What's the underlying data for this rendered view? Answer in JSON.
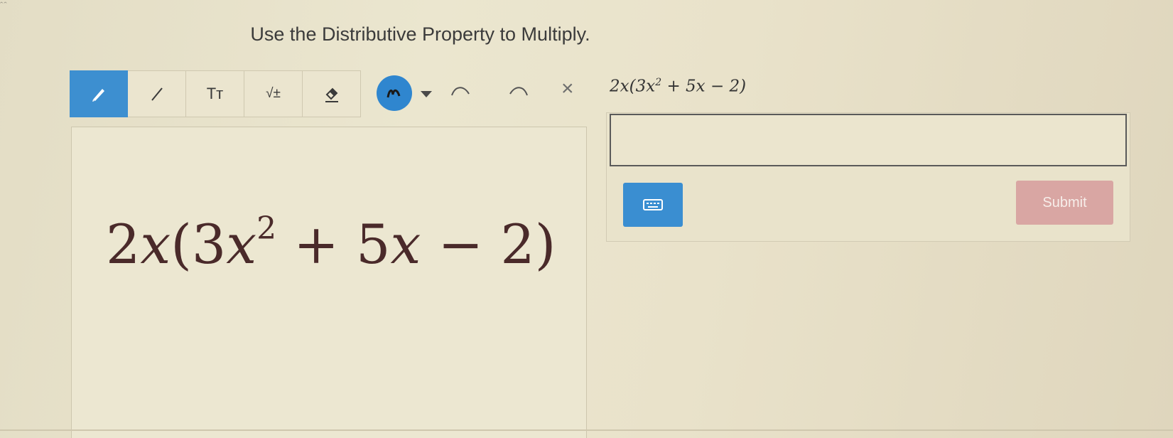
{
  "question": "Use the Distributive Property to Multiply.",
  "toolbar": {
    "text_tool": "Tт",
    "math_tool": "√±"
  },
  "expression": {
    "coefficient": "2",
    "variable": "x",
    "open": "(3",
    "exponent": "2",
    "middle": " + 5",
    "tail": " − 2)"
  },
  "clear_symbol": "×",
  "submit_label": "Submit",
  "colors": {
    "accent": "#3d8fd0",
    "submit": "#d9a6a3",
    "expression": "#4a2a2a"
  },
  "icons": [
    "pen-icon",
    "line-icon",
    "text-icon",
    "math-icon",
    "fill-icon",
    "color-picker-icon",
    "undo-icon",
    "redo-icon",
    "clear-icon",
    "keyboard-icon"
  ]
}
